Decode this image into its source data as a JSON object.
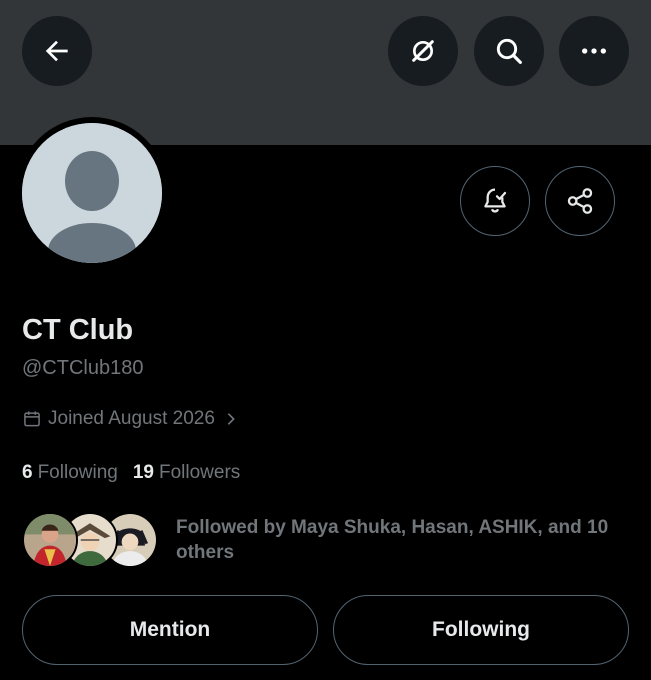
{
  "header": {
    "icons": [
      "arrow-left-icon",
      "grok-icon",
      "search-icon",
      "more-icon"
    ],
    "banner_color": "#333639"
  },
  "profile": {
    "display_name": "CT Club",
    "handle": "@CTClub180",
    "joined": "Joined August 2026",
    "following_count": "6",
    "following_label": "Following",
    "followers_count": "19",
    "followers_label": "Followers",
    "followed_by": "Followed by Maya Shuka, Hasan, ASHIK, and 10 others"
  },
  "actions": {
    "notify_icon": "bell-check-icon",
    "share_icon": "share-icon",
    "mention_label": "Mention",
    "following_label": "Following"
  },
  "colors": {
    "background": "#000000",
    "primary_text": "#e7e9ea",
    "secondary_text": "#71767b",
    "border": "#536471"
  }
}
